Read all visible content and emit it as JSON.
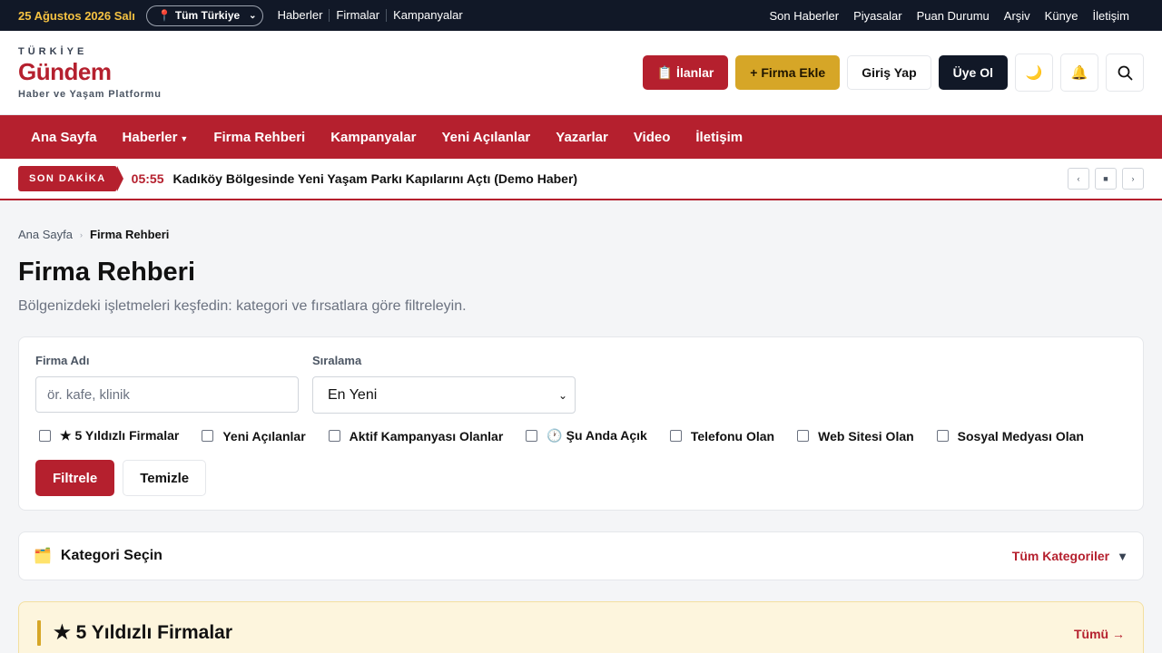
{
  "topbar": {
    "date": "25 Ağustos 2026 Salı",
    "region": "Tüm Türkiye",
    "left_links": [
      "Haberler",
      "Firmalar",
      "Kampanyalar"
    ],
    "right_links": [
      "Son Haberler",
      "Piyasalar",
      "Puan Durumu",
      "Arşiv",
      "Künye",
      "İletişim"
    ]
  },
  "logo": {
    "kicker": "TÜRKİYE",
    "name": "Gündem",
    "tagline": "Haber ve Yaşam Platformu"
  },
  "header_actions": {
    "ilanlar": "📋 İlanlar",
    "firma_ekle": "+ Firma Ekle",
    "giris": "Giriş Yap",
    "uye": "Üye Ol",
    "theme_icon": "🌙",
    "bell_icon": "🔔"
  },
  "nav": {
    "items": [
      "Ana Sayfa",
      "Haberler",
      "Firma Rehberi",
      "Kampanyalar",
      "Yeni Açılanlar",
      "Yazarlar",
      "Video",
      "İletişim"
    ]
  },
  "breaking": {
    "label": "SON DAKİKA",
    "time": "05:55",
    "title": "Kadıköy Bölgesinde Yeni Yaşam Parkı Kapılarını Açtı (Demo Haber)"
  },
  "breadcrumb": {
    "home": "Ana Sayfa",
    "current": "Firma Rehberi"
  },
  "page": {
    "title": "Firma Rehberi",
    "subtitle": "Bölgenizdeki işletmeleri keşfedin: kategori ve fırsatlara göre filtreleyin."
  },
  "filters": {
    "name_label": "Firma Adı",
    "name_placeholder": "ör. kafe, klinik",
    "sort_label": "Sıralama",
    "sort_value": "En Yeni",
    "checkboxes": [
      "★ 5 Yıldızlı Firmalar",
      "Yeni Açılanlar",
      "Aktif Kampanyası Olanlar",
      "🕐 Şu Anda Açık",
      "Telefonu Olan",
      "Web Sitesi Olan",
      "Sosyal Medyası Olan"
    ],
    "filter_btn": "Filtrele",
    "clear_btn": "Temizle"
  },
  "category": {
    "title": "Kategori Seçin",
    "all": "Tüm Kategoriler"
  },
  "featured": {
    "title": "★ 5 Yıldızlı Firmalar",
    "all": "Tümü →"
  },
  "colors": {
    "brand_red": "#b5202e",
    "gold": "#d6a627",
    "dark": "#111827"
  }
}
